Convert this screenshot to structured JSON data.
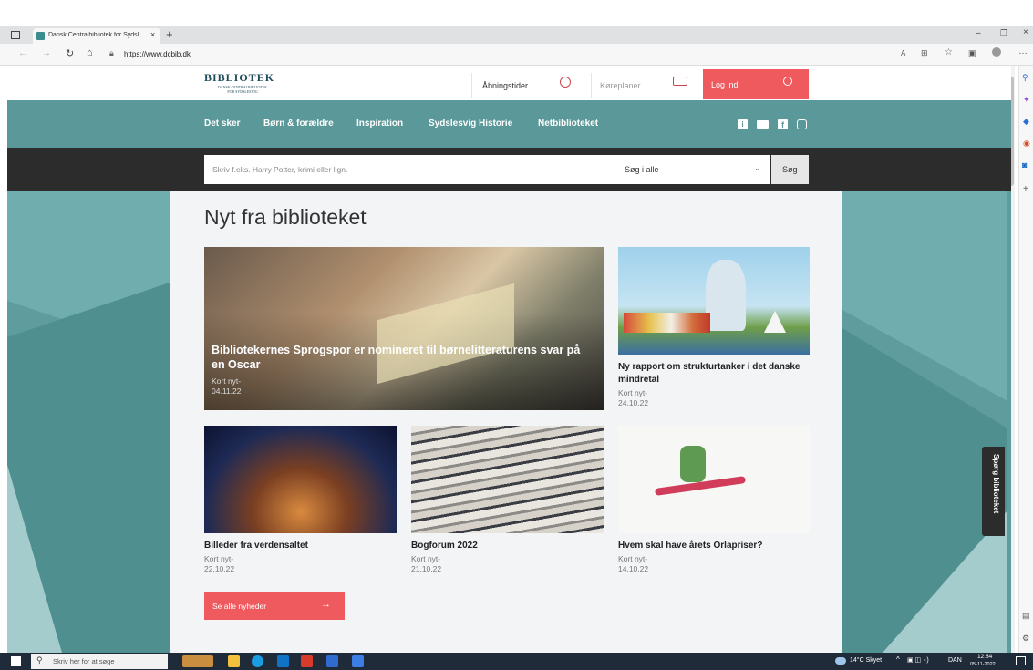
{
  "browser": {
    "tab_title": "Dansk Centralbibliotek for Sydsl",
    "url": "https://www.dcbib.dk"
  },
  "header": {
    "logo_text": "BIBLIOTEK",
    "logo_sub": "DANSK CENTRALBIBLIOTEK\nFOR SYDSLESVIG",
    "opening_hours": "Åbningstider",
    "bus_schedule": "Køreplaner",
    "login": "Log ind"
  },
  "nav": {
    "items": [
      "Det sker",
      "Børn & forældre",
      "Inspiration",
      "Sydslesvig Historie",
      "Netbiblioteket"
    ]
  },
  "search": {
    "placeholder": "Skriv f.eks. Harry Potter, krimi eller lign.",
    "scope": "Søg i alle",
    "button": "Søg"
  },
  "news": {
    "heading": "Nyt fra biblioteket",
    "featured": {
      "title": "Bibliotekernes Sprogspor er nomineret til børnelitteraturens svar på en Oscar",
      "meta": "Kort nyt-\n04.11.22"
    },
    "items": [
      {
        "title": "Ny rapport om strukturtanker i det danske mindretal",
        "meta": "Kort nyt-\n24.10.22"
      },
      {
        "title": "Billeder fra verdensaltet",
        "meta": "Kort nyt-\n22.10.22"
      },
      {
        "title": "Bogforum 2022",
        "meta": "Kort nyt-\n21.10.22"
      },
      {
        "title": "Hvem skal have årets Orlapriser?",
        "meta": "Kort nyt-\n14.10.22"
      }
    ],
    "see_all": "Se alle nyheder"
  },
  "side_tab": "Spørg biblioteket",
  "taskbar": {
    "search_placeholder": "Skriv her for at søge",
    "weather": "14°C Skyet",
    "lang": "DAN",
    "time": "12:54",
    "date": "05-11-2022"
  },
  "colors": {
    "teal": "#5a9899",
    "coral": "#ef5a5f",
    "dark": "#2c2c2c"
  }
}
